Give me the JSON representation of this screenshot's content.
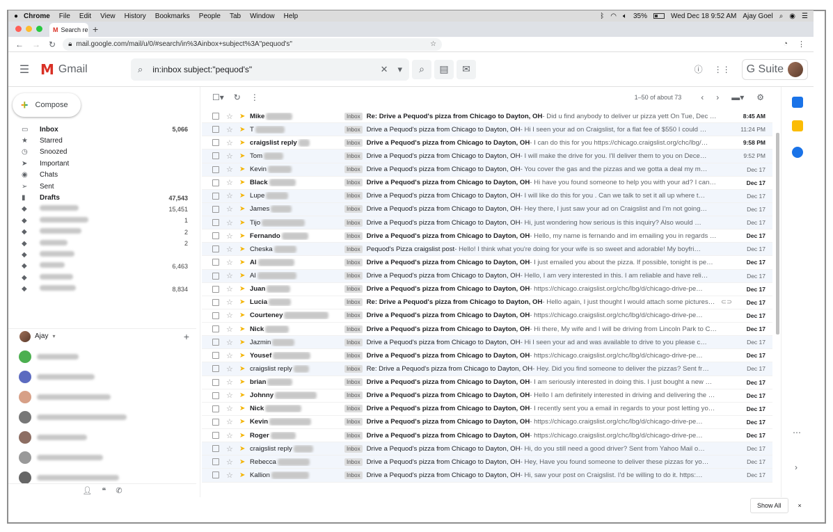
{
  "menubar": {
    "items": [
      "Chrome",
      "File",
      "Edit",
      "View",
      "History",
      "Bookmarks",
      "People",
      "Tab",
      "Window",
      "Help"
    ],
    "battery": "35%",
    "datetime": "Wed Dec 18  9:52 AM",
    "user": "Ajay Goel",
    "battery_level": 0.35
  },
  "tab": {
    "label": "Search re",
    "close": "×"
  },
  "address": {
    "url": "mail.google.com/mail/u/0/#search/in%3Ainbox+subject%3A\"pequod's\""
  },
  "gmail": {
    "logo_text": "Gmail",
    "search_query": "in:inbox subject:\"pequod's\"",
    "gsuite": "G Suite",
    "compose": "Compose"
  },
  "nav": [
    {
      "label": "Inbox",
      "count": "5,066",
      "icon": "inbox-icon",
      "bold": true
    },
    {
      "label": "Starred",
      "count": "",
      "icon": "star-icon",
      "bold": false
    },
    {
      "label": "Snoozed",
      "count": "",
      "icon": "clock-icon",
      "bold": false
    },
    {
      "label": "Important",
      "count": "",
      "icon": "important-icon",
      "bold": false
    },
    {
      "label": "Chats",
      "count": "",
      "icon": "chat-icon",
      "bold": false
    },
    {
      "label": "Sent",
      "count": "",
      "icon": "send-icon",
      "bold": false
    },
    {
      "label": "Drafts",
      "count": "47,543",
      "icon": "draft-icon",
      "bold": true
    },
    {
      "label": "",
      "count": "15,451",
      "icon": "label-icon",
      "bold": false
    },
    {
      "label": "",
      "count": "1",
      "icon": "label-icon",
      "bold": false
    },
    {
      "label": "",
      "count": "2",
      "icon": "label-icon",
      "bold": false
    },
    {
      "label": "",
      "count": "2",
      "icon": "label-icon",
      "bold": false
    },
    {
      "label": "",
      "count": "",
      "icon": "label-icon",
      "bold": false
    },
    {
      "label": "",
      "count": "6,463",
      "icon": "label-icon",
      "bold": false
    },
    {
      "label": "",
      "count": "",
      "icon": "label-icon",
      "bold": false
    },
    {
      "label": "",
      "count": "8,834",
      "icon": "label-icon",
      "bold": false
    }
  ],
  "hangouts": {
    "user": "Ajay"
  },
  "toolbar": {
    "pagination": "1–50 of about 73"
  },
  "badge": "Inbox",
  "emails": [
    {
      "sender": "Mike",
      "subject": "Re: Drive a Pequod's pizza from Chicago to Dayton, OH",
      "preview": " - Did u find anybody to deliver ur pizza yett On Tue, Dec …",
      "date": "8:45 AM",
      "unread": true
    },
    {
      "sender": "T",
      "subject": "Drive a Pequod's pizza from Chicago to Dayton, OH",
      "preview": " - Hi I seen your ad on Craigslist, for a flat fee of $550 I could …",
      "date": "11:24 PM",
      "unread": false
    },
    {
      "sender": "craigslist reply",
      "subject": "Drive a Pequod's pizza from Chicago to Dayton, OH",
      "preview": " - I can do this for you https://chicago.craigslist.org/chc/lbg/…",
      "date": "9:58 PM",
      "unread": true
    },
    {
      "sender": "Tom",
      "subject": "Drive a Pequod's pizza from Chicago to Dayton, OH",
      "preview": " - I will make the drive for you. I'll deliver them to you on Dece…",
      "date": "9:52 PM",
      "unread": false
    },
    {
      "sender": "Kevin",
      "subject": "Drive a Pequod's pizza from Chicago to Dayton, OH",
      "preview": " - You cover the gas and the pizzas and we gotta a deal my m…",
      "date": "Dec 17",
      "unread": false
    },
    {
      "sender": "Black",
      "subject": "Drive a Pequod's pizza from Chicago to Dayton, OH",
      "preview": " - Hi have you found someone to help you with your ad? I can …",
      "date": "Dec 17",
      "unread": true
    },
    {
      "sender": "Lupe",
      "subject": "Drive a Pequod's pizza from Chicago to Dayton, OH",
      "preview": " - I will like do this for you . Can we talk to set it all up where t…",
      "date": "Dec 17",
      "unread": false
    },
    {
      "sender": "James",
      "subject": "Drive a Pequod's pizza from Chicago to Dayton, OH",
      "preview": " - Hey there, I just saw your ad on Craigslist and I'm not going…",
      "date": "Dec 17",
      "unread": false
    },
    {
      "sender": "Tijo",
      "subject": "Drive a Pequod's pizza from Chicago to Dayton, OH",
      "preview": " - Hi, just wondering how serious is this inquiry? Also would …",
      "date": "Dec 17",
      "unread": false
    },
    {
      "sender": "Fernando",
      "subject": "Drive a Pequod's pizza from Chicago to Dayton, OH",
      "preview": " - Hello, my name is fernando and im emailing you in regards …",
      "date": "Dec 17",
      "unread": true
    },
    {
      "sender": "Cheska",
      "subject": "Pequod's Pizza craigslist post",
      "preview": " - Hello! I think what you're doing for your wife is so sweet and adorable! My boyfri…",
      "date": "Dec 17",
      "unread": false
    },
    {
      "sender": "Al",
      "subject": "Drive a Pequod's pizza from Chicago to Dayton, OH",
      "preview": " - I just emailed you about the pizza. If possible, tonight is pe…",
      "date": "Dec 17",
      "unread": true
    },
    {
      "sender": "Al",
      "subject": "Drive a Pequod's pizza from Chicago to Dayton, OH",
      "preview": " - Hello, I am very interested in this. I am reliable and have reli…",
      "date": "Dec 17",
      "unread": false
    },
    {
      "sender": "Juan",
      "subject": "Drive a Pequod's pizza from Chicago to Dayton, OH",
      "preview": " - https://chicago.craigslist.org/chc/lbg/d/chicago-drive-pe…",
      "date": "Dec 17",
      "unread": true
    },
    {
      "sender": "Lucia",
      "subject": "Re: Drive a Pequod's pizza from Chicago to Dayton, OH",
      "preview": " - Hello again, I just thought I would attach some pictures…",
      "date": "Dec 17",
      "unread": true,
      "attach": true
    },
    {
      "sender": "Courteney",
      "subject": "Drive a Pequod's pizza from Chicago to Dayton, OH",
      "preview": " - https://chicago.craigslist.org/chc/lbg/d/chicago-drive-pe…",
      "date": "Dec 17",
      "unread": true
    },
    {
      "sender": "Nick",
      "subject": "Drive a Pequod's pizza from Chicago to Dayton, OH",
      "preview": " - Hi there, My wife and I will be driving from Lincoln Park to C…",
      "date": "Dec 17",
      "unread": true
    },
    {
      "sender": "Jazmin",
      "subject": "Drive a Pequod's pizza from Chicago to Dayton, OH",
      "preview": " - Hi I seen your ad and was available to drive to you please c…",
      "date": "Dec 17",
      "unread": false
    },
    {
      "sender": "Yousef",
      "subject": "Drive a Pequod's pizza from Chicago to Dayton, OH",
      "preview": " - https://chicago.craigslist.org/chc/lbg/d/chicago-drive-pe…",
      "date": "Dec 17",
      "unread": true
    },
    {
      "sender": "craigslist reply",
      "subject": "Re: Drive a Pequod's pizza from Chicago to Dayton, OH",
      "preview": " - Hey. Did you find someone to deliver the pizzas? Sent fr…",
      "date": "Dec 17",
      "unread": false
    },
    {
      "sender": "brian",
      "subject": "Drive a Pequod's pizza from Chicago to Dayton, OH",
      "preview": " - I am seriously interested in doing this. I just bought a new …",
      "date": "Dec 17",
      "unread": true
    },
    {
      "sender": "Johnny",
      "subject": "Drive a Pequod's pizza from Chicago to Dayton, OH",
      "preview": " - Hello I am definitely interested in driving and delivering the …",
      "date": "Dec 17",
      "unread": true
    },
    {
      "sender": "Nick",
      "subject": "Drive a Pequod's pizza from Chicago to Dayton, OH",
      "preview": " - I recently sent you a email in regards to your post letting yo…",
      "date": "Dec 17",
      "unread": true
    },
    {
      "sender": "Kevin",
      "subject": "Drive a Pequod's pizza from Chicago to Dayton, OH",
      "preview": " - https://chicago.craigslist.org/chc/lbg/d/chicago-drive-pe…",
      "date": "Dec 17",
      "unread": true
    },
    {
      "sender": "Roger",
      "subject": "Drive a Pequod's pizza from Chicago to Dayton, OH",
      "preview": " - https://chicago.craigslist.org/chc/lbg/d/chicago-drive-pe…",
      "date": "Dec 17",
      "unread": true
    },
    {
      "sender": "craigslist reply",
      "subject": "Drive a Pequod's pizza from Chicago to Dayton, OH",
      "preview": " - Hi, do you still need a good driver? Sent from Yahoo Mail o…",
      "date": "Dec 17",
      "unread": false
    },
    {
      "sender": "Rebecca",
      "subject": "Drive a Pequod's pizza from Chicago to Dayton, OH",
      "preview": " - Hey, Have you found someone to deliver these pizzas for yo…",
      "date": "Dec 17",
      "unread": false
    },
    {
      "sender": "Kallion",
      "subject": "Drive a Pequod's pizza from Chicago to Dayton, OH",
      "preview": " - Hi, saw your post on Craigslist. I'd be willing to do it. https:…",
      "date": "Dec 17",
      "unread": false
    }
  ],
  "footer": {
    "show_all": "Show All",
    "close": "×"
  }
}
